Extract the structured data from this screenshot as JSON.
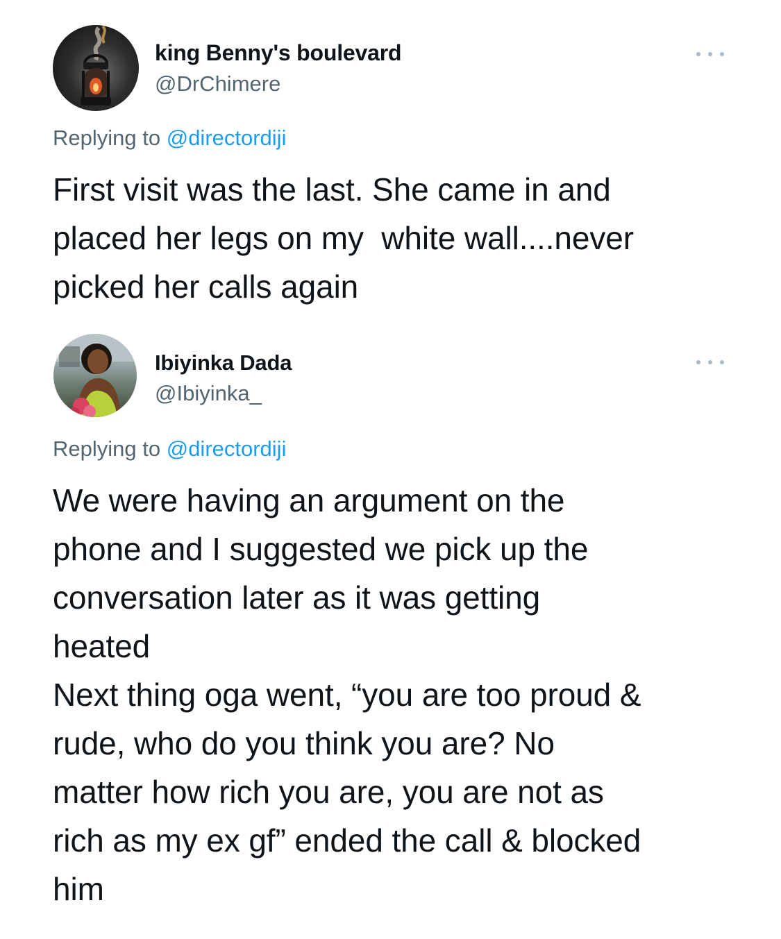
{
  "tweets": [
    {
      "display_name": "king Benny's boulevard",
      "handle": "@DrChimere",
      "avatar_icon": "lantern-icon",
      "replying_label": "Replying to ",
      "replying_to": "@directordiji",
      "text": "First visit was the last. She came in and\nplaced her legs on my  white wall....never\npicked her calls again"
    },
    {
      "display_name": "Ibiyinka Dada",
      "handle": "@Ibiyinka_",
      "avatar_icon": "profile-photo",
      "replying_label": "Replying to ",
      "replying_to": "@directordiji",
      "text": "We were having an argument on the\nphone and I suggested we pick up the\nconversation later as it was getting\nheated\nNext thing oga went, “you are too proud &\nrude, who do you think you are? No\nmatter how rich you are, you are not as\nrich as my ex gf” ended the call & blocked\nhim"
    }
  ],
  "colors": {
    "text": "#0f1419",
    "secondary": "#536471",
    "mention": "#1d9bf0",
    "more_dots": "#aab8c2"
  }
}
